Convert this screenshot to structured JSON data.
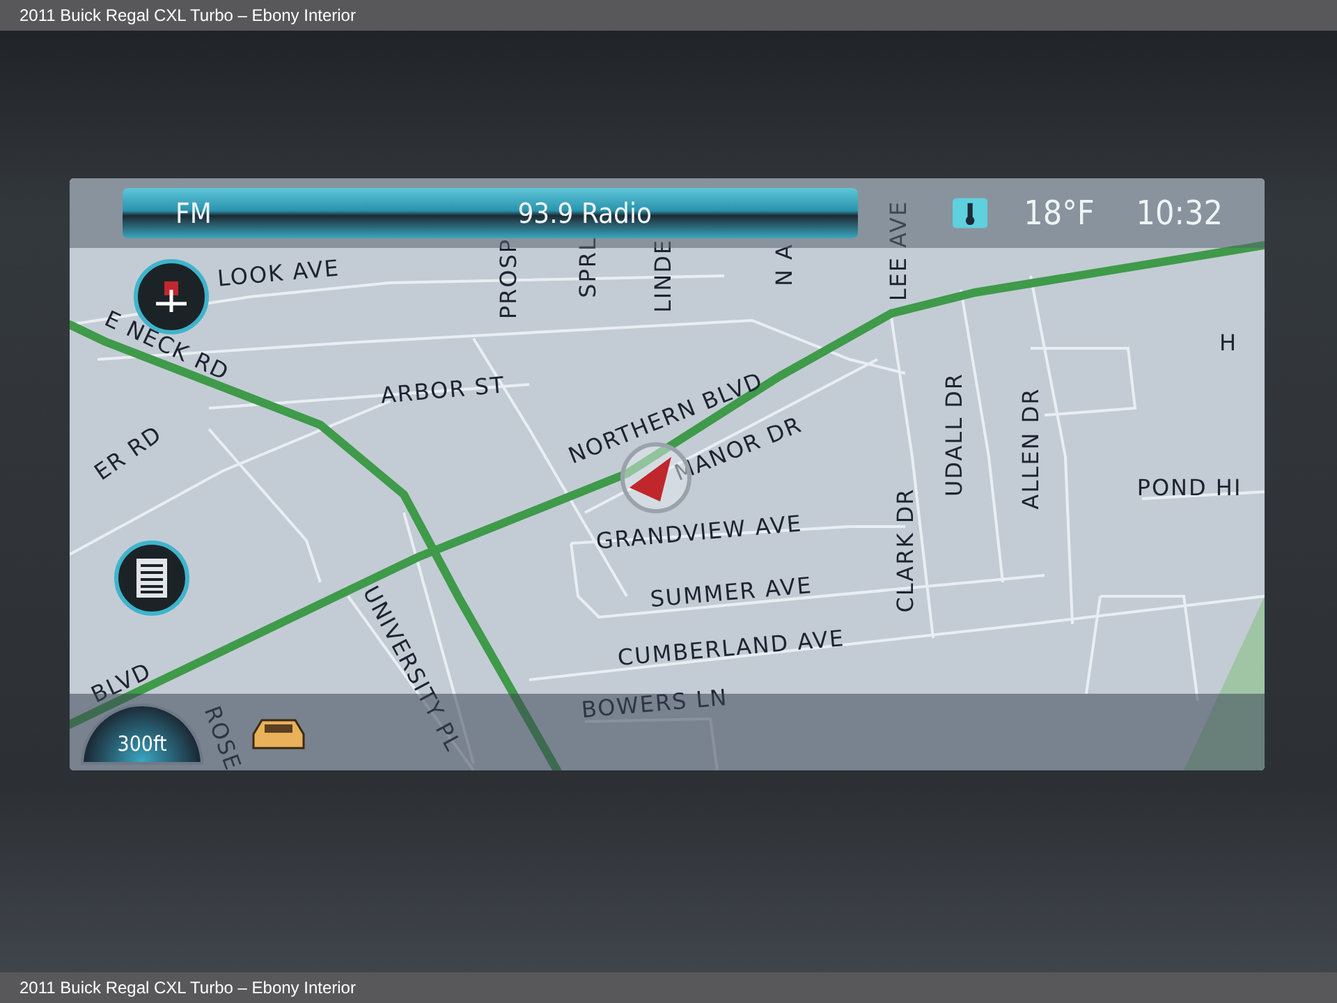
{
  "caption_top": "2011 Buick Regal CXL Turbo – Ebony Interior",
  "nav": {
    "radio": {
      "band": "FM",
      "station": "93.9 Radio"
    },
    "temperature": "18°F",
    "clock": "10:32",
    "distance": "300ft",
    "streets": [
      "LOOK AVE",
      "PROSP",
      "SPRL",
      "LINDE",
      "N A",
      "LEE AVE",
      "E NECK RD",
      "ARBOR ST",
      "NORTHERN BLVD",
      "MANOR DR",
      "UDALL DR",
      "ALLEN DR",
      "ER RD",
      "H",
      "POND HI",
      "GRANDVIEW AVE",
      "CLARK DR",
      "SUMMER AVE",
      "CUMBERLAND AVE",
      "BLVD",
      "UNIVERSITY PL",
      "BOWERS LN",
      "ROSE"
    ]
  },
  "caption_bottom": "2011 Buick Regal CXL Turbo – Ebony Interior"
}
